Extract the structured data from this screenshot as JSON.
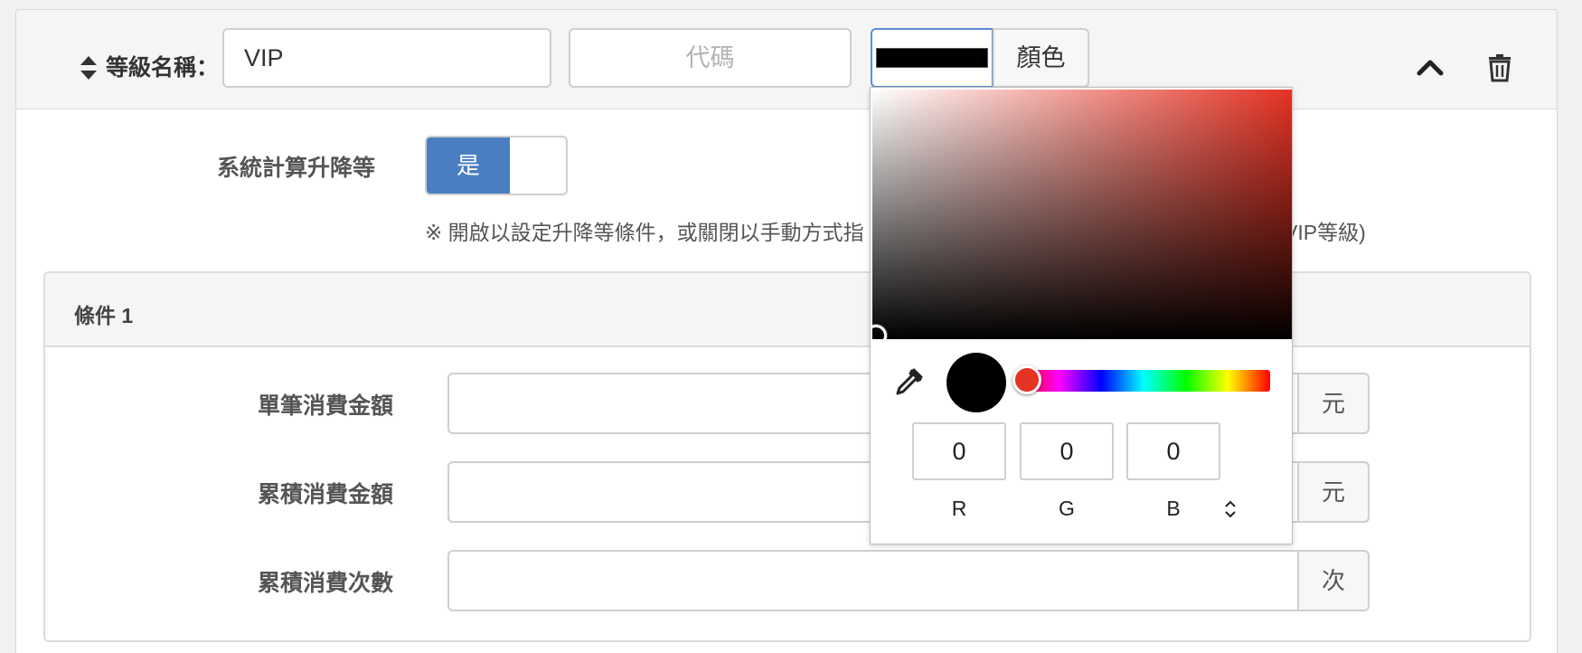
{
  "header": {
    "level_label": "等級名稱：",
    "name_value": "VIP",
    "code_placeholder": "代碼",
    "color_button": "顏色",
    "swatch_color": "#000000"
  },
  "settings": {
    "calc_label": "系統計算升降等",
    "toggle_on_label": "是",
    "note": "※ 開啟以設定升降等條件，或關閉以手動方式指",
    "note_tail": "VIP等級)"
  },
  "condition": {
    "title": "條件 1",
    "rows": [
      {
        "label": "單筆消費金額",
        "unit": "元"
      },
      {
        "label": "累積消費金額",
        "unit": "元"
      },
      {
        "label": "累積消費次數",
        "unit": "次"
      }
    ]
  },
  "picker": {
    "hue_color": "#e53324",
    "r": "0",
    "g": "0",
    "b": "0",
    "r_label": "R",
    "g_label": "G",
    "b_label": "B"
  }
}
